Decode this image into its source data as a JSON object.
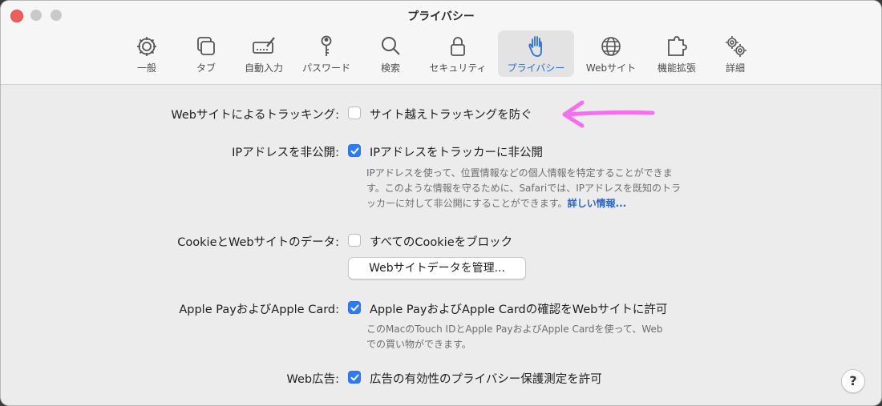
{
  "window": {
    "title": "プライバシー"
  },
  "toolbar": {
    "items": [
      {
        "label": "一般",
        "icon": "gear-icon"
      },
      {
        "label": "タブ",
        "icon": "tabs-icon"
      },
      {
        "label": "自動入力",
        "icon": "autofill-icon"
      },
      {
        "label": "パスワード",
        "icon": "key-icon"
      },
      {
        "label": "検索",
        "icon": "magnifier-icon"
      },
      {
        "label": "セキュリティ",
        "icon": "lock-icon"
      },
      {
        "label": "プライバシー",
        "icon": "hand-icon",
        "selected": true
      },
      {
        "label": "Webサイト",
        "icon": "globe-icon"
      },
      {
        "label": "機能拡張",
        "icon": "puzzle-icon"
      },
      {
        "label": "詳細",
        "icon": "gears-icon"
      }
    ]
  },
  "settings": {
    "tracking": {
      "label": "Webサイトによるトラッキング:",
      "option": "サイト越えトラッキングを防ぐ",
      "checked": false
    },
    "ip": {
      "label": "IPアドレスを非公開:",
      "option": "IPアドレスをトラッカーに非公開",
      "checked": true,
      "desc_line1": "IPアドレスを使って、位置情報などの個人情報を特定することができま",
      "desc_line2": "す。このような情報を守るために、Safariでは、IPアドレスを既知のトラ",
      "desc_line3": "ッカーに対して非公開にすることができます。",
      "link": "詳しい情報..."
    },
    "cookie": {
      "label": "CookieとWebサイトのデータ:",
      "option": "すべてのCookieをブロック",
      "checked": false,
      "button": "Webサイトデータを管理..."
    },
    "applepay": {
      "label": "Apple PayおよびApple Card:",
      "option": "Apple PayおよびApple Cardの確認をWebサイトに許可",
      "checked": true,
      "desc_line1": "このMacのTouch IDとApple PayおよびApple Cardを使って、Web",
      "desc_line2": "での買い物ができます。"
    },
    "ads": {
      "label": "Web広告:",
      "option": "広告の有効性のプライバシー保護測定を許可",
      "checked": true
    }
  },
  "help": {
    "label": "?"
  },
  "annotation": {
    "color": "#f36ef0"
  },
  "colors": {
    "accent": "#2d7cf6",
    "selected_tab": "#2a70d6"
  }
}
